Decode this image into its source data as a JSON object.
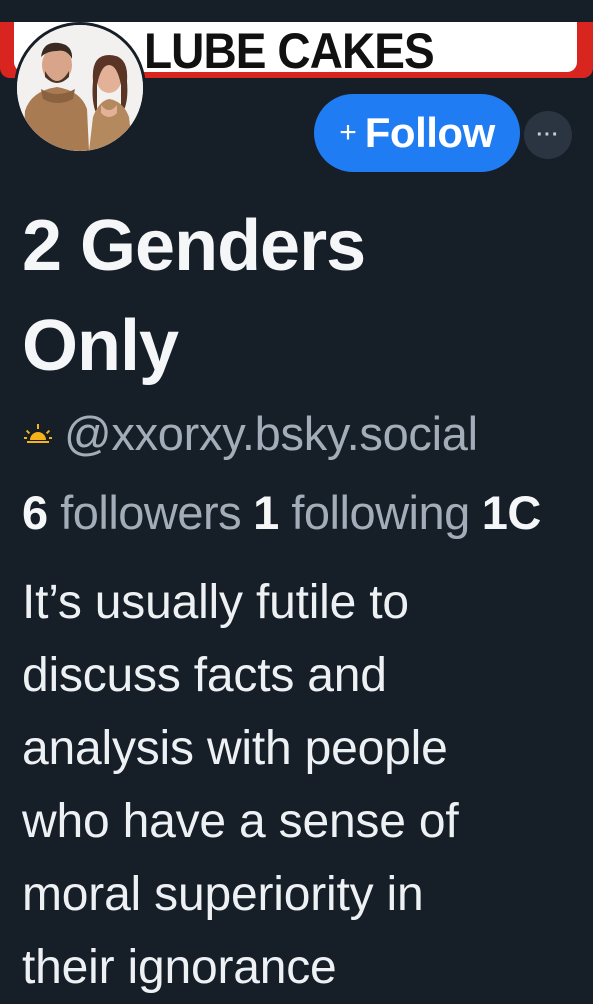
{
  "banner": {
    "text": "LUBE CAKES"
  },
  "profile": {
    "display_name_lines": [
      "2 Genders",
      "Only"
    ],
    "handle": "@xxorxy.bsky.social"
  },
  "actions": {
    "follow_plus": "+",
    "follow_label": "Follow",
    "more_label": "···"
  },
  "stats": {
    "followers_count": "6",
    "followers_label": "followers",
    "following_count": "1",
    "following_label": "following",
    "posts_count_partial": "1C"
  },
  "bio": {
    "lines": [
      "It’s usually futile to",
      "discuss facts and",
      "analysis with people",
      "who have a sense of",
      "moral superiority in",
      "their ignorance"
    ]
  },
  "icons": {
    "sun": "sunrise-icon",
    "avatar": "profile-avatar"
  },
  "colors": {
    "background": "#161e27",
    "follow_button": "#1f7cf2",
    "secondary_text": "#a3adb9",
    "banner_red": "#d8251f"
  }
}
